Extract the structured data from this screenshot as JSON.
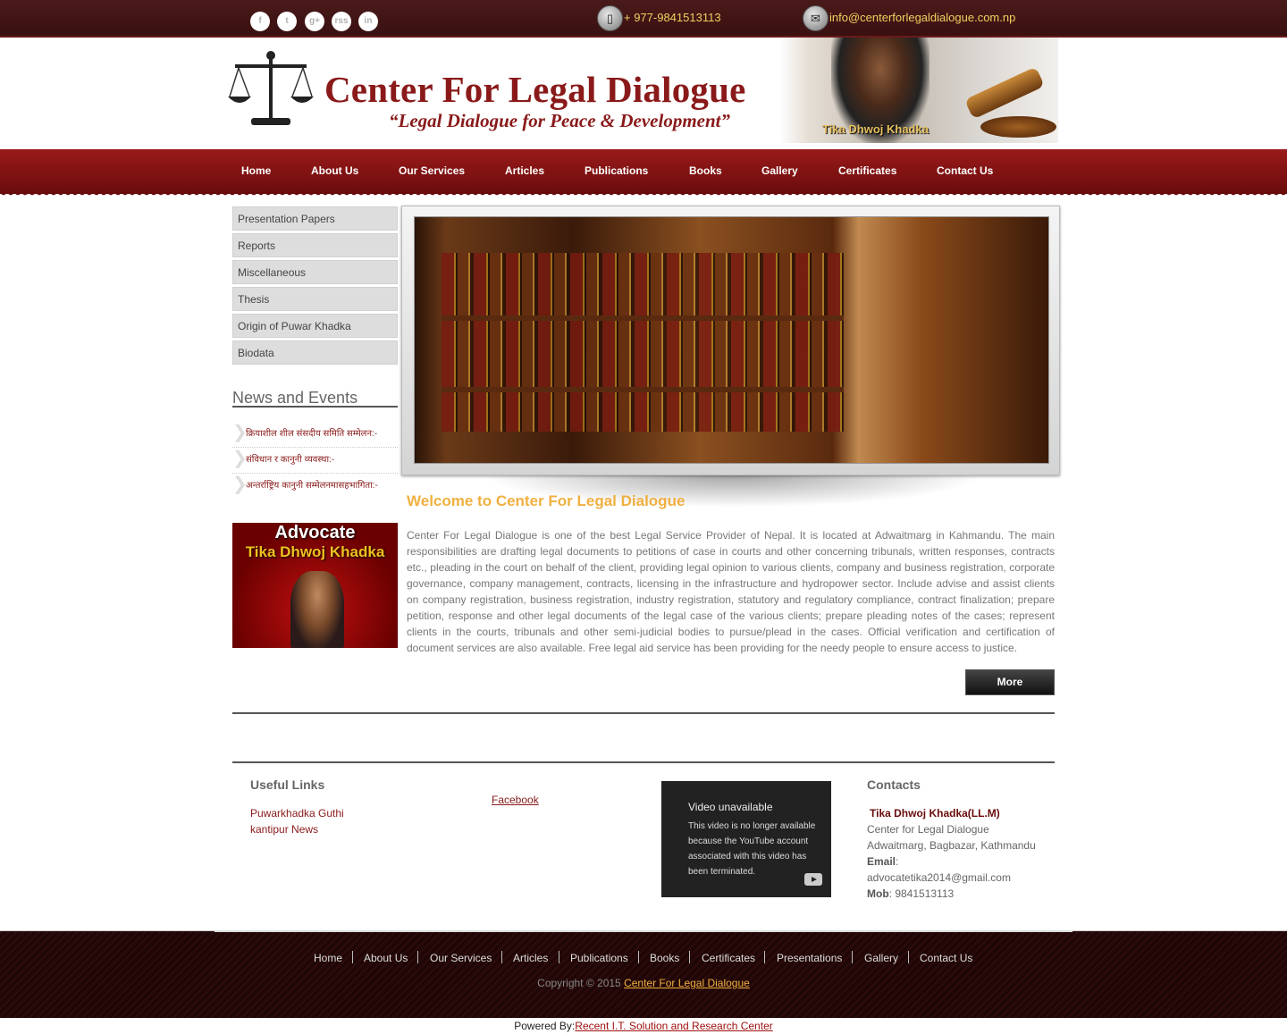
{
  "topbar": {
    "social": [
      "f",
      "t",
      "g+",
      "rss",
      "in"
    ],
    "social_icons": [
      "facebook-icon",
      "twitter-icon",
      "google-plus-icon",
      "rss-icon",
      "linkedin-icon"
    ],
    "phone": "+ 977-9841513113",
    "email": "info@centerforlegaldialogue.com.np"
  },
  "header": {
    "title": "Center For Legal Dialogue",
    "tagline": "“Legal Dialogue for Peace & Development”",
    "banner_name": "Tika Dhwoj Khadka"
  },
  "nav": [
    "Home",
    "About Us",
    "Our Services",
    "Articles",
    "Publications",
    "Books",
    "Gallery",
    "Certificates",
    "Contact Us"
  ],
  "sidebar": {
    "items": [
      "Presentation Papers",
      "Reports",
      "Miscellaneous",
      "Thesis",
      "Origin of Puwar Khadka",
      "Biodata"
    ],
    "news_title": "News and Events",
    "news": [
      "क्रियाशील शील संसदीय समिति सम्मेलन:-",
      "संविधान र कानुनी व्यवस्था:-",
      "अन्तर्राष्ट्रिय कानुनी सम्मेलनमासहभागिता:-"
    ],
    "card_title": "Advocate",
    "card_name": "Tika Dhwoj Khadka"
  },
  "welcome": {
    "title": "Welcome to Center For Legal Dialogue",
    "text": "Center For Legal Dialogue is one of the best Legal Service Provider of Nepal. It is located at Adwaitmarg in Kahmandu. The main responsibilities are drafting legal documents to petitions of case in courts and other concerning tribunals, written responses, contracts etc., pleading in the court on behalf of the client, providing legal opinion to various clients, company and business registration, corporate governance, company management, contracts, licensing in the infrastructure and hydropower sector. Include advise and assist clients on company registration, business registration, industry registration, statutory and regulatory compliance, contract finalization; prepare petition, response and other legal documents of the legal case of the various clients; prepare pleading notes of the cases; represent clients in the courts, tribunals and other semi-judicial bodies to pursue/plead in the cases. Official verification and certification of document services are also available. Free legal aid service has been providing for the needy people to ensure access to justice.",
    "more": "More"
  },
  "footer_widgets": {
    "useful_title": "Useful Links",
    "useful_links": [
      "Puwarkhadka Guthi",
      "kantipur News"
    ],
    "facebook": "Facebook",
    "video_title": "Video unavailable",
    "video_text": "This video is no longer available because the YouTube account associated with this video has been terminated.",
    "contacts_title": "Contacts",
    "contact_name": "Tika Dhwoj Khadka(LL.M)",
    "contact_org": "Center for Legal Dialogue",
    "contact_address": "Adwaitmarg, Bagbazar, Kathmandu",
    "email_label": "Email",
    "email_sep": ":",
    "email_value": "advocatetika2014@gmail.com",
    "mob_label": "Mob",
    "mob_value": ": 9841513113"
  },
  "footer": {
    "links": [
      "Home",
      "About Us",
      "Our Services",
      "Articles",
      "Publications",
      "Books",
      "Certificates",
      "Presentations",
      "Gallery",
      "Contact Us"
    ],
    "copyright": "Copyright © 2015",
    "copyright_link": "Center For Legal Dialogue",
    "powered_label": "Powered By:",
    "powered_link": "Recent I.T. Solution and Research Center"
  }
}
